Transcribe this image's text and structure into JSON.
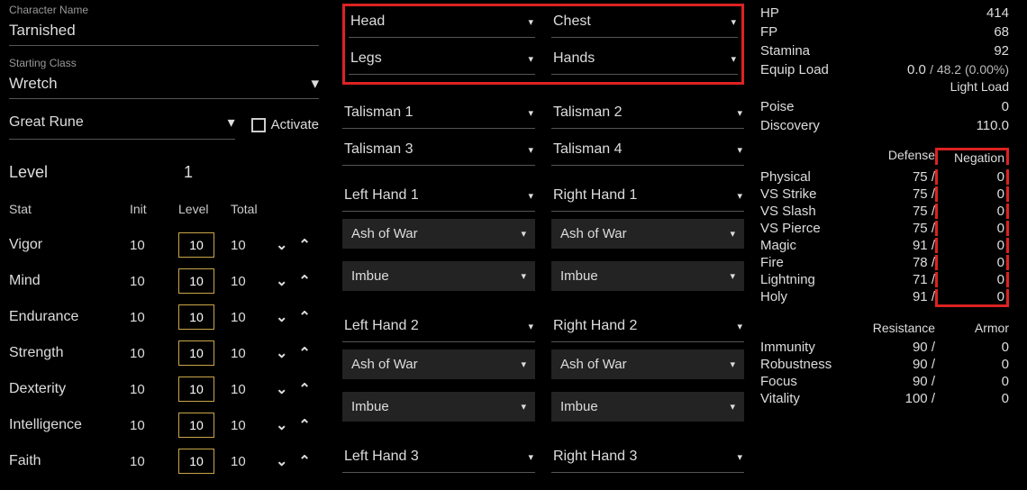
{
  "character": {
    "name_label": "Character Name",
    "name": "Tarnished",
    "class_label": "Starting Class",
    "class": "Wretch",
    "great_rune_label": "Great Rune",
    "activate_label": "Activate",
    "level_label": "Level",
    "level": "1"
  },
  "stat_headers": {
    "stat": "Stat",
    "init": "Init",
    "level": "Level",
    "total": "Total"
  },
  "stats": [
    {
      "name": "Vigor",
      "init": "10",
      "level": "10",
      "total": "10"
    },
    {
      "name": "Mind",
      "init": "10",
      "level": "10",
      "total": "10"
    },
    {
      "name": "Endurance",
      "init": "10",
      "level": "10",
      "total": "10"
    },
    {
      "name": "Strength",
      "init": "10",
      "level": "10",
      "total": "10"
    },
    {
      "name": "Dexterity",
      "init": "10",
      "level": "10",
      "total": "10"
    },
    {
      "name": "Intelligence",
      "init": "10",
      "level": "10",
      "total": "10"
    },
    {
      "name": "Faith",
      "init": "10",
      "level": "10",
      "total": "10"
    }
  ],
  "armor": {
    "head": "Head",
    "chest": "Chest",
    "legs": "Legs",
    "hands": "Hands"
  },
  "talismans": {
    "t1": "Talisman 1",
    "t2": "Talisman 2",
    "t3": "Talisman 3",
    "t4": "Talisman 4"
  },
  "hands": {
    "l1": "Left Hand 1",
    "r1": "Right Hand 1",
    "l2": "Left Hand 2",
    "r2": "Right Hand 2",
    "l3": "Left Hand 3",
    "r3": "Right Hand 3",
    "aow": "Ash of War",
    "imbue": "Imbue"
  },
  "right": {
    "hp_label": "HP",
    "hp": "414",
    "fp_label": "FP",
    "fp": "68",
    "stamina_label": "Stamina",
    "stamina": "92",
    "equip_label": "Equip Load",
    "equip_val": "0.0",
    "equip_sub": "/ 48.2 (0.00%)",
    "load_tag": "Light Load",
    "poise_label": "Poise",
    "poise": "0",
    "discovery_label": "Discovery",
    "discovery": "110.0"
  },
  "def_headers": {
    "defense": "Defense",
    "negation": "Negation"
  },
  "defense": [
    {
      "name": "Physical",
      "def": "75 /",
      "neg": "0"
    },
    {
      "name": "VS Strike",
      "def": "75 /",
      "neg": "0"
    },
    {
      "name": "VS Slash",
      "def": "75 /",
      "neg": "0"
    },
    {
      "name": "VS Pierce",
      "def": "75 /",
      "neg": "0"
    },
    {
      "name": "Magic",
      "def": "91 /",
      "neg": "0"
    },
    {
      "name": "Fire",
      "def": "78 /",
      "neg": "0"
    },
    {
      "name": "Lightning",
      "def": "71 /",
      "neg": "0"
    },
    {
      "name": "Holy",
      "def": "91 /",
      "neg": "0"
    }
  ],
  "res_headers": {
    "resistance": "Resistance",
    "armor": "Armor"
  },
  "resistance": [
    {
      "name": "Immunity",
      "def": "90 /",
      "neg": "0"
    },
    {
      "name": "Robustness",
      "def": "90 /",
      "neg": "0"
    },
    {
      "name": "Focus",
      "def": "90 /",
      "neg": "0"
    },
    {
      "name": "Vitality",
      "def": "100 /",
      "neg": "0"
    }
  ],
  "glyph": {
    "caret": "▾",
    "down": "⌄",
    "up": "⌃"
  }
}
